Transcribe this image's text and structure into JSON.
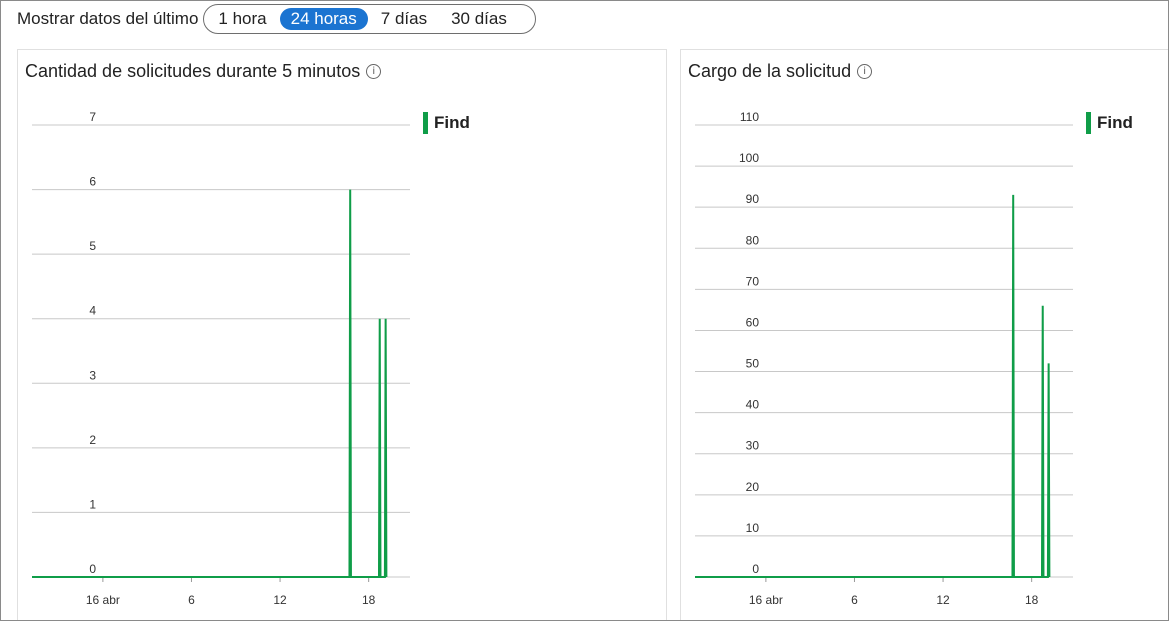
{
  "range_selector": {
    "label": "Mostrar datos del último",
    "options": [
      "1 hora",
      "24 horas",
      "7 días",
      "30 días"
    ],
    "selected": "24 horas"
  },
  "info_icon_glyph": "i",
  "colors": {
    "accent": "#1b74d1",
    "series": "#0f9d48",
    "grid": "#c8c8c8"
  },
  "panels": [
    {
      "title": "Cantidad de solicitudes durante 5 minutos",
      "legend": "Find"
    },
    {
      "title": "Cargo de la solicitud",
      "legend": "Find"
    }
  ],
  "chart_data": [
    {
      "type": "area",
      "title": "Cantidad de solicitudes durante 5 minutos",
      "xlabel": "",
      "ylabel": "",
      "ylim": [
        0,
        7
      ],
      "yticks": [
        0,
        1,
        2,
        3,
        4,
        5,
        6,
        7
      ],
      "xlim": [
        -4.8,
        20.8
      ],
      "xticks": [
        {
          "x": 0,
          "label": "16 abr"
        },
        {
          "x": 6,
          "label": "6"
        },
        {
          "x": 12,
          "label": "12"
        },
        {
          "x": 18,
          "label": "18"
        }
      ],
      "grid": true,
      "legend_position": "top-right",
      "series": [
        {
          "name": "Find",
          "x": [
            -4.8,
            16.7,
            16.75,
            16.8,
            18.7,
            18.75,
            18.8,
            19.1,
            19.15,
            19.2
          ],
          "y": [
            0,
            0,
            6,
            0,
            0,
            4,
            0,
            0,
            4,
            0
          ]
        }
      ]
    },
    {
      "type": "area",
      "title": "Cargo de la solicitud",
      "xlabel": "",
      "ylabel": "",
      "ylim": [
        0,
        110
      ],
      "yticks": [
        0,
        10,
        20,
        30,
        40,
        50,
        60,
        70,
        80,
        90,
        100,
        110
      ],
      "xlim": [
        -4.8,
        20.8
      ],
      "xticks": [
        {
          "x": 0,
          "label": "16 abr"
        },
        {
          "x": 6,
          "label": "6"
        },
        {
          "x": 12,
          "label": "12"
        },
        {
          "x": 18,
          "label": "18"
        }
      ],
      "grid": true,
      "legend_position": "top-right",
      "series": [
        {
          "name": "Find",
          "x": [
            -4.8,
            16.7,
            16.75,
            16.8,
            18.7,
            18.75,
            18.8,
            19.1,
            19.15,
            19.2
          ],
          "y": [
            0,
            0,
            93,
            0,
            0,
            66,
            0,
            0,
            52,
            0
          ]
        }
      ]
    }
  ]
}
